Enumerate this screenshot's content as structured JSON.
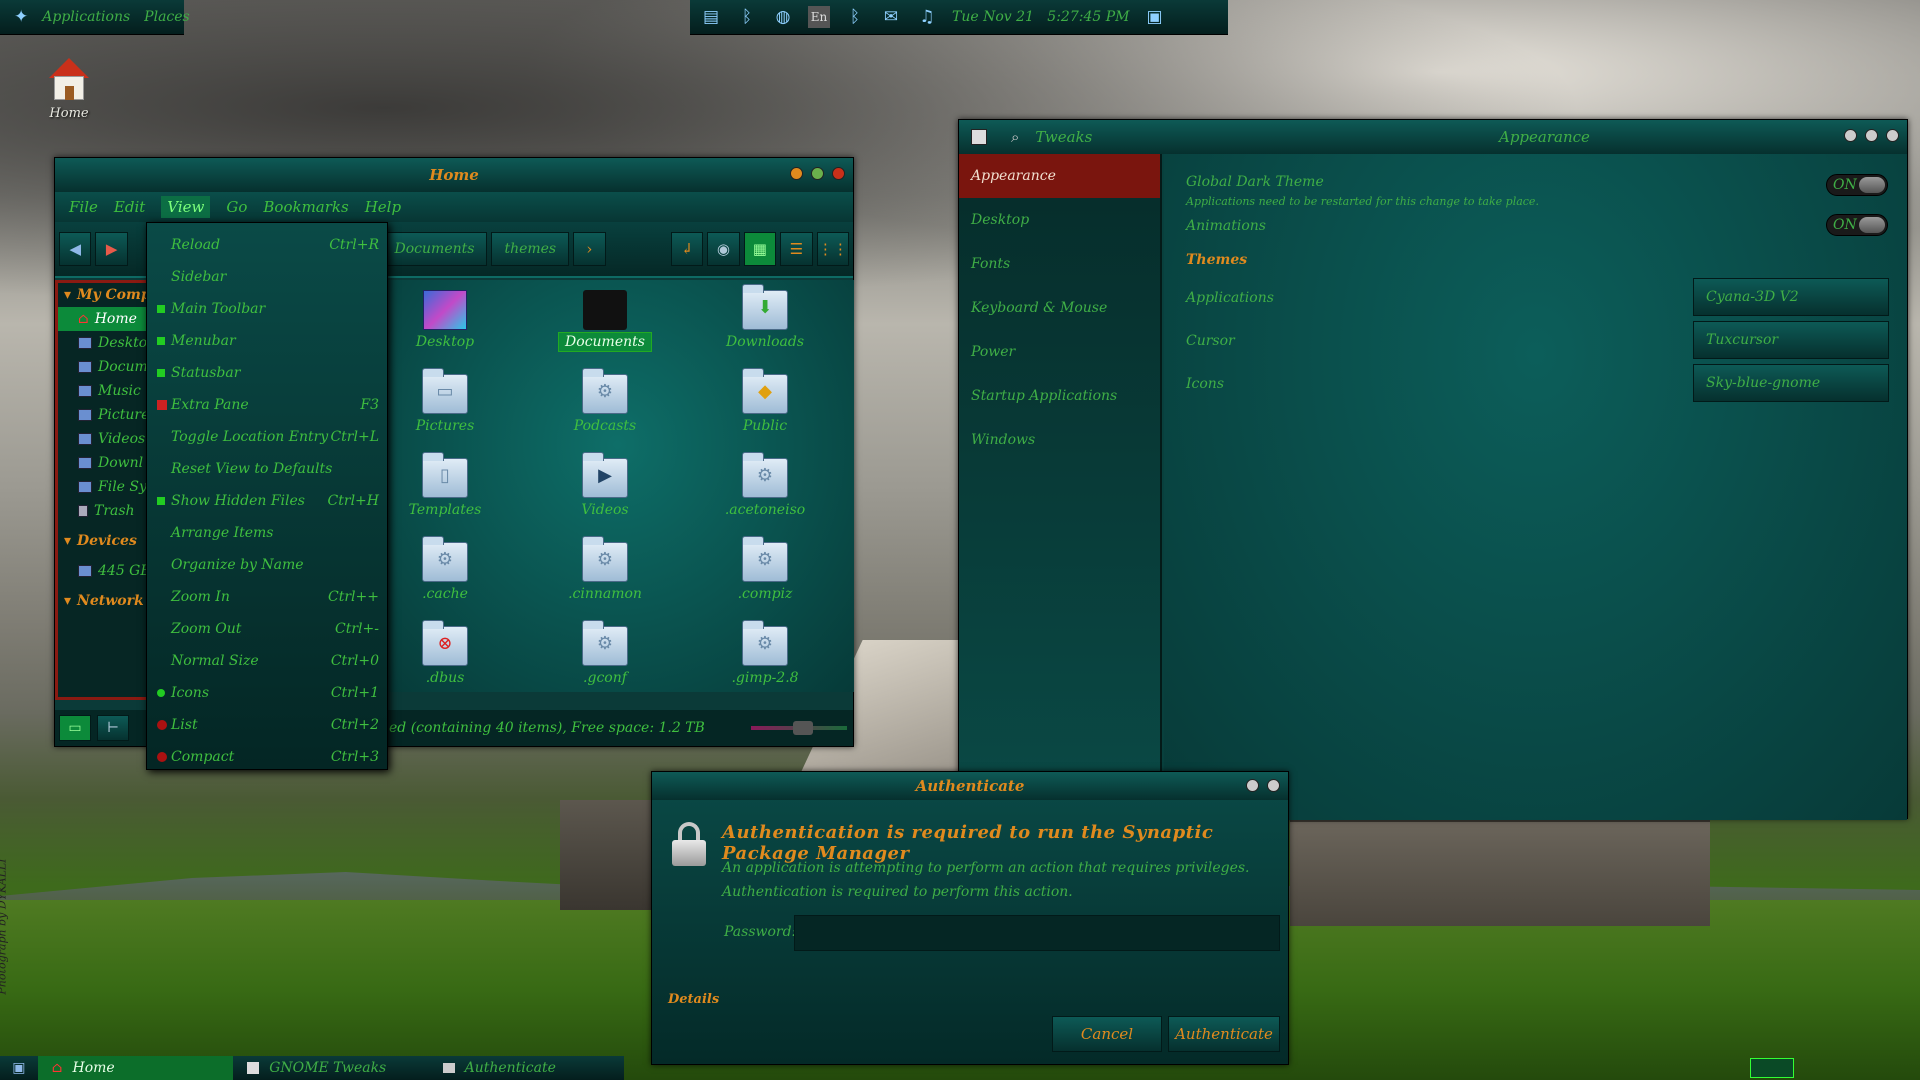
{
  "top_panel": {
    "applications": "Applications",
    "places": "Places",
    "datetime": "Tue Nov 21   5:27:45 PM",
    "lang": "En"
  },
  "desktop": {
    "home_label": "Home"
  },
  "nautilus": {
    "title": "Home",
    "menus": [
      "File",
      "Edit",
      "View",
      "Go",
      "Bookmarks",
      "Help"
    ],
    "breadcrumbs": [
      "Documents",
      "themes"
    ],
    "sidebar": {
      "my_computer": "My Comp",
      "items": [
        "Home",
        "Deskto",
        "Docum",
        "Music",
        "Picture",
        "Videos",
        "Downl",
        "File Sy",
        "Trash"
      ],
      "devices": "Devices",
      "device_item": "445 GB",
      "network": "Network"
    },
    "files": [
      "Desktop",
      "Documents",
      "Downloads",
      "Pictures",
      "Podcasts",
      "Public",
      "Templates",
      "Videos",
      ".acetoneiso",
      ".cache",
      ".cinnamon",
      ".compiz",
      ".dbus",
      ".gconf",
      ".gimp-2.8"
    ],
    "status": "ed (containing 40 items), Free space: 1.2 TB"
  },
  "view_menu": {
    "items": [
      {
        "label": "Reload",
        "accel": "Ctrl+R"
      },
      {
        "label": "Sidebar",
        "accel": ""
      },
      {
        "label": "Main Toolbar",
        "accel": ""
      },
      {
        "label": "Menubar",
        "accel": ""
      },
      {
        "label": "Statusbar",
        "accel": ""
      },
      {
        "label": "Extra Pane",
        "accel": "F3"
      },
      {
        "label": "Toggle Location Entry",
        "accel": "Ctrl+L"
      },
      {
        "label": "Reset View to Defaults",
        "accel": ""
      },
      {
        "label": "Show Hidden Files",
        "accel": "Ctrl+H"
      },
      {
        "label": "Arrange Items",
        "accel": ""
      },
      {
        "label": "Organize by Name",
        "accel": ""
      },
      {
        "label": "Zoom In",
        "accel": "Ctrl++"
      },
      {
        "label": "Zoom Out",
        "accel": "Ctrl+-"
      },
      {
        "label": "Normal Size",
        "accel": "Ctrl+0"
      },
      {
        "label": "Icons",
        "accel": "Ctrl+1"
      },
      {
        "label": "List",
        "accel": "Ctrl+2"
      },
      {
        "label": "Compact",
        "accel": "Ctrl+3"
      }
    ]
  },
  "tweaks": {
    "app": "Tweaks",
    "title": "Appearance",
    "sidebar": [
      "Appearance",
      "Desktop",
      "Fonts",
      "Keyboard & Mouse",
      "Power",
      "Startup Applications",
      "Windows"
    ],
    "global_dark": "Global Dark Theme",
    "global_dark_note": "Applications need to be restarted for this change to take place.",
    "animations": "Animations",
    "switch_on": "ON",
    "themes_header": "Themes",
    "applications_label": "Applications",
    "cursor_label": "Cursor",
    "icons_label": "Icons",
    "applications_value": "Cyana-3D V2",
    "cursor_value": "Tuxcursor",
    "icons_value": "Sky-blue-gnome"
  },
  "auth": {
    "title": "Authenticate",
    "heading": "Authentication is required to run the Synaptic Package Manager",
    "line1": "An application is attempting to perform an action that requires privileges.",
    "line2": "Authentication is required to perform this action.",
    "password_label": "Password:",
    "details": "Details",
    "cancel": "Cancel",
    "authenticate": "Authenticate"
  },
  "bottom_panel": {
    "tasks": [
      "Home",
      "GNOME Tweaks",
      "Authenticate"
    ]
  },
  "watermark": "Photograph by DYKALLI",
  "colors": {
    "accent_green": "#3fbf3f",
    "accent_orange": "#e08a1e",
    "panel_teal": "#0a3a38",
    "selected_red": "#7a150e"
  }
}
